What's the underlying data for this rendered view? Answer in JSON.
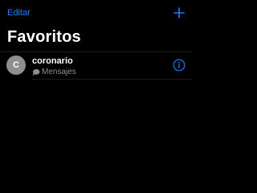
{
  "header": {
    "edit_label": "Editar",
    "add_icon": "plus-icon"
  },
  "title": "Favoritos",
  "favorites": [
    {
      "avatar_initial": "C",
      "name": "coronario",
      "type_label": "Mensajes",
      "type_icon": "message-bubble-icon",
      "info_icon": "info-icon"
    }
  ],
  "colors": {
    "background": "#000000",
    "accent": "#0a84ff",
    "secondary_text": "#8e8e93",
    "avatar_bg": "#8e8e93",
    "separator": "#1c1c1e"
  }
}
